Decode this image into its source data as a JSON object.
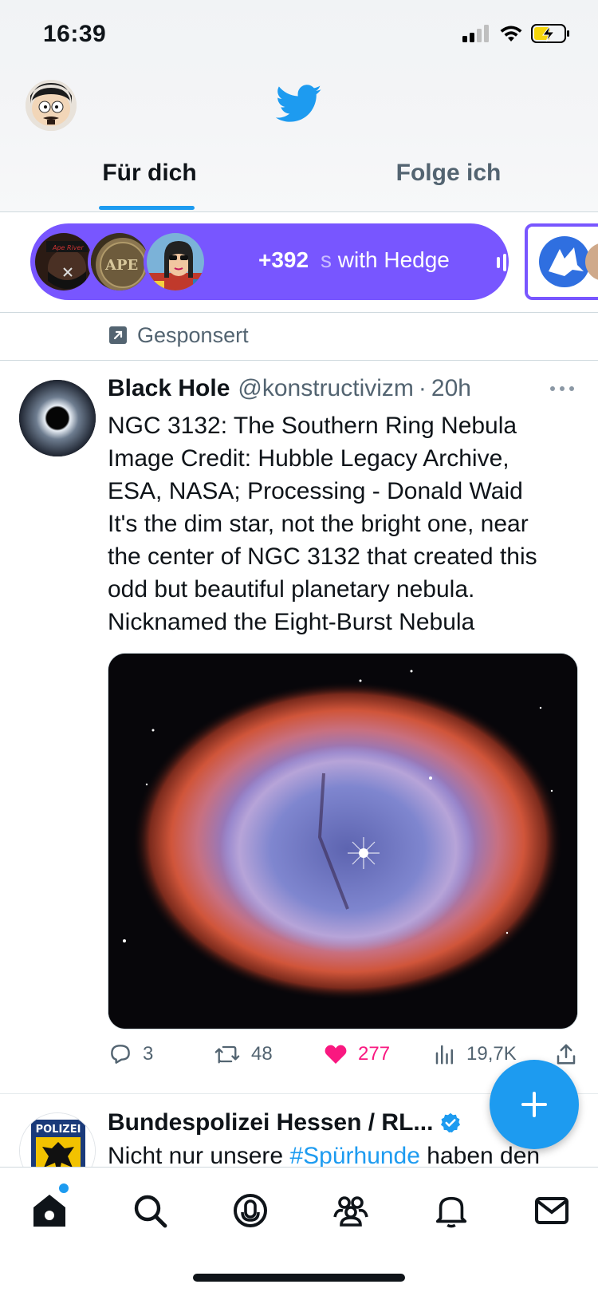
{
  "status_bar": {
    "time": "16:39",
    "icons": [
      "signal-icon",
      "wifi-icon",
      "battery-charging-icon"
    ]
  },
  "header": {
    "avatar_icon": "profile-avatar",
    "logo_icon": "twitter-bird-icon",
    "tabs": [
      {
        "label": "Für dich",
        "active": true
      },
      {
        "label": "Folge ich",
        "active": false
      }
    ],
    "accent_color": "#1d9bf0"
  },
  "spaces": {
    "count_label": "+392",
    "title_dim": "s",
    "title": "with Hedge",
    "pill_color": "#7856ff",
    "avatars": [
      "space-listener-avatar-1",
      "space-listener-avatar-2",
      "space-listener-avatar-3"
    ],
    "live_icon": "live-audio-bars-icon",
    "next_icon": "wolf-space-icon"
  },
  "sponsored": {
    "icon": "promoted-arrow-icon",
    "label": "Gesponsert"
  },
  "tweet": {
    "name": "Black Hole",
    "handle": "@konstructivizm",
    "separator": "·",
    "time": "20h",
    "more_icon": "more-dots-icon",
    "text_lines": [
      "NGC 3132: The Southern Ring Nebula",
      "Image Credit: Hubble Legacy Archive,",
      "ESA, NASA; Processing - Donald Waid",
      "It's the dim star, not the bright one, near",
      "the center of NGC 3132 that created this",
      "odd but beautiful planetary nebula.",
      "Nicknamed the Eight-Burst Nebula"
    ],
    "media_icon": "nebula-image",
    "actions": {
      "replies": "3",
      "retweets": "48",
      "likes": "277",
      "views": "19,7K"
    },
    "like_color": "#f91880"
  },
  "tweet2": {
    "name": "Bundespolizei Hessen / RL...",
    "verified_icon": "verified-badge-icon",
    "avatar_label": "POLIZEI",
    "text_before": "Nicht nur unsere ",
    "hashtag": "#Spürhunde",
    "text_after": " haben den"
  },
  "fab": {
    "icon": "plus-icon"
  },
  "bottom_nav": {
    "items": [
      "home-icon",
      "search-icon",
      "spaces-icon",
      "communities-icon",
      "notifications-icon",
      "messages-icon"
    ]
  }
}
